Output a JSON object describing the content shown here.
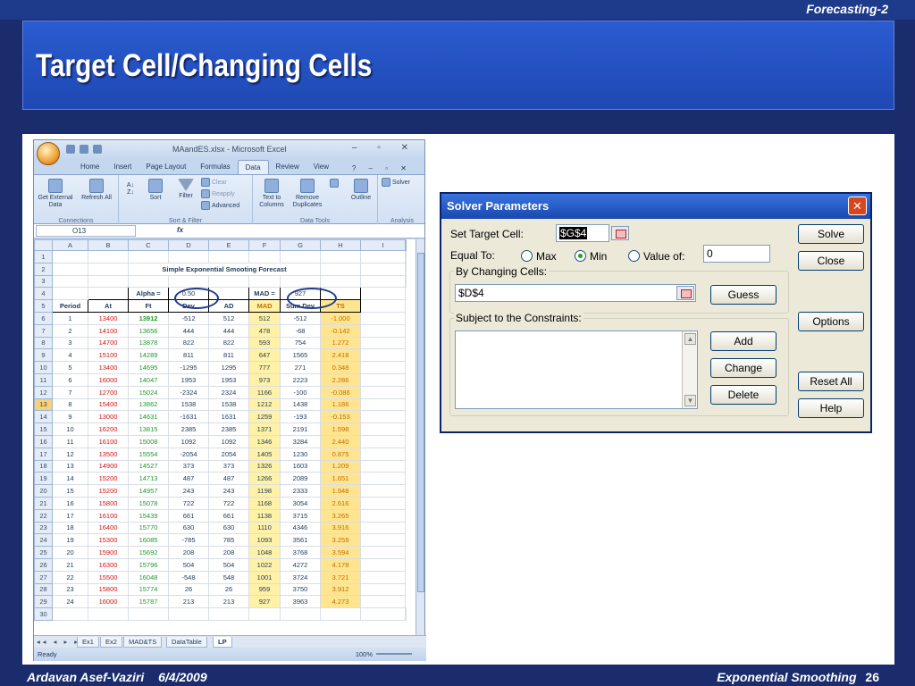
{
  "slide": {
    "tag": "Forecasting-2",
    "title": "Target Cell/Changing Cells",
    "footer_author": "Ardavan Asef-Vaziri",
    "footer_date": "6/4/2009",
    "footer_topic": "Exponential Smoothing",
    "page_number": "26",
    "colors": {
      "background": "#1a2c6b",
      "title_band": "#2a5bd0",
      "oval": "#1c3a8c"
    }
  },
  "excel": {
    "window_title": "MAandES.xlsx - Microsoft Excel",
    "tabs": [
      "Home",
      "Insert",
      "Page Layout",
      "Formulas",
      "Data",
      "Review",
      "View"
    ],
    "active_tab": "Data",
    "ribbon": {
      "get_external_data": "Get External Data",
      "refresh_all": "Refresh All",
      "connections_label": "Connections",
      "sort": "Sort",
      "filter": "Filter",
      "clear": "Clear",
      "reapply": "Reapply",
      "advanced": "Advanced",
      "sort_filter_label": "Sort & Filter",
      "text_to_columns": "Text to Columns",
      "remove_duplicates": "Remove Duplicates",
      "data_tools_label": "Data Tools",
      "outline": "Outline",
      "solver": "Solver",
      "analysis_label": "Analysis"
    },
    "name_box": "O13",
    "fx": "fx",
    "columns": [
      "A",
      "B",
      "C",
      "D",
      "E",
      "F",
      "G",
      "H",
      "I"
    ],
    "sheet_title": "Simple Exponential Smooting Forecast",
    "alpha_label": "Alpha =",
    "alpha_value": "0.50",
    "mad_label": "MAD =",
    "mad_value": "927",
    "headers": [
      "Period",
      "At",
      "Ft",
      "Dev",
      "AD",
      "MAD",
      "Sum Dev",
      "TS"
    ],
    "rows": [
      [
        "1",
        "13400",
        "13912",
        "-512",
        "512",
        "512",
        "-512",
        "-1.000"
      ],
      [
        "2",
        "14100",
        "13656",
        "444",
        "444",
        "478",
        "-68",
        "-0.142"
      ],
      [
        "3",
        "14700",
        "13878",
        "822",
        "822",
        "593",
        "754",
        "1.272"
      ],
      [
        "4",
        "15100",
        "14289",
        "811",
        "811",
        "647",
        "1565",
        "2.418"
      ],
      [
        "5",
        "13400",
        "14695",
        "-1295",
        "1295",
        "777",
        "271",
        "0.348"
      ],
      [
        "6",
        "16000",
        "14047",
        "1953",
        "1953",
        "973",
        "2223",
        "2.286"
      ],
      [
        "7",
        "12700",
        "15024",
        "-2324",
        "2324",
        "1166",
        "-100",
        "-0.086"
      ],
      [
        "8",
        "15400",
        "13862",
        "1538",
        "1538",
        "1212",
        "1438",
        "1.186"
      ],
      [
        "9",
        "13000",
        "14631",
        "-1631",
        "1631",
        "1259",
        "-193",
        "-0.153"
      ],
      [
        "10",
        "16200",
        "13815",
        "2385",
        "2385",
        "1371",
        "2191",
        "1.598"
      ],
      [
        "11",
        "16100",
        "15008",
        "1092",
        "1092",
        "1346",
        "3284",
        "2.440"
      ],
      [
        "12",
        "13500",
        "15554",
        "-2054",
        "2054",
        "1405",
        "1230",
        "0.875"
      ],
      [
        "13",
        "14900",
        "14527",
        "373",
        "373",
        "1326",
        "1603",
        "1.209"
      ],
      [
        "14",
        "15200",
        "14713",
        "487",
        "487",
        "1266",
        "2089",
        "1.651"
      ],
      [
        "15",
        "15200",
        "14957",
        "243",
        "243",
        "1198",
        "2333",
        "1.948"
      ],
      [
        "16",
        "15800",
        "15078",
        "722",
        "722",
        "1168",
        "3054",
        "2.616"
      ],
      [
        "17",
        "16100",
        "15439",
        "661",
        "661",
        "1138",
        "3715",
        "3.265"
      ],
      [
        "18",
        "16400",
        "15770",
        "630",
        "630",
        "1110",
        "4346",
        "3.916"
      ],
      [
        "19",
        "15300",
        "16085",
        "-785",
        "785",
        "1093",
        "3561",
        "3.259"
      ],
      [
        "20",
        "15900",
        "15692",
        "208",
        "208",
        "1048",
        "3768",
        "3.594"
      ],
      [
        "21",
        "16300",
        "15796",
        "504",
        "504",
        "1022",
        "4272",
        "4.178"
      ],
      [
        "22",
        "15500",
        "16048",
        "-548",
        "548",
        "1001",
        "3724",
        "3.721"
      ],
      [
        "23",
        "15800",
        "15774",
        "26",
        "26",
        "959",
        "3750",
        "3.912"
      ],
      [
        "24",
        "16000",
        "15787",
        "213",
        "213",
        "927",
        "3963",
        "4.273"
      ]
    ],
    "sheet_tabs": [
      "Ex1",
      "Ex2",
      "MAD&TS",
      "DataTable",
      "LP"
    ],
    "active_sheet": "LP",
    "status": "Ready",
    "zoom": "100%"
  },
  "solver": {
    "title": "Solver Parameters",
    "set_target_label": "Set Target Cell:",
    "target_cell": "$G$4",
    "equal_to_label": "Equal To:",
    "max_label": "Max",
    "min_label": "Min",
    "value_of_label": "Value of:",
    "value_of": "0",
    "selected": "Min",
    "by_changing_label": "By Changing Cells:",
    "changing_cells": "$D$4",
    "constraints_label": "Subject to the Constraints:",
    "buttons": {
      "solve": "Solve",
      "close": "Close",
      "guess": "Guess",
      "options": "Options",
      "add": "Add",
      "change": "Change",
      "delete": "Delete",
      "reset_all": "Reset All",
      "help": "Help"
    }
  }
}
